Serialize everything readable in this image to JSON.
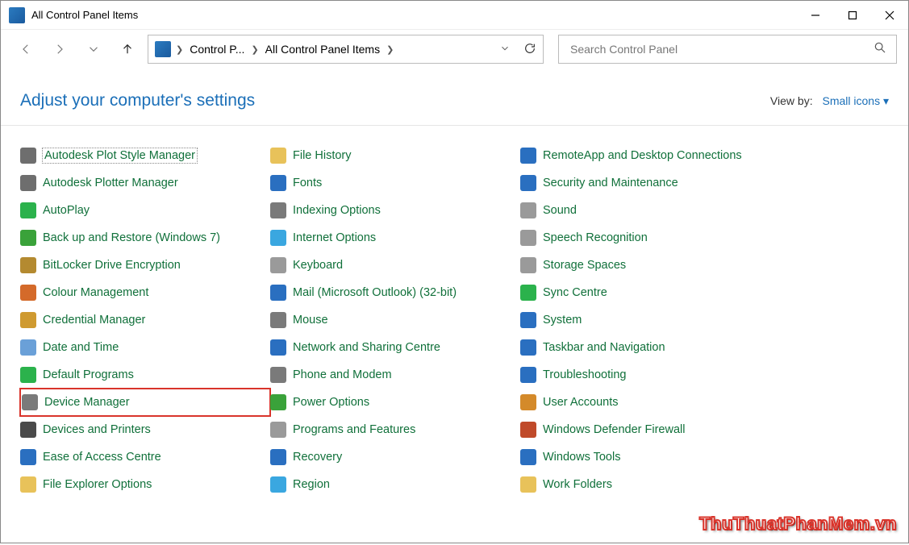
{
  "window": {
    "title": "All Control Panel Items"
  },
  "breadcrumb": {
    "item0": "Control P...",
    "item1": "All Control Panel Items"
  },
  "search": {
    "placeholder": "Search Control Panel"
  },
  "header": {
    "title": "Adjust your computer's settings",
    "viewby_label": "View by:",
    "viewby_value": "Small icons"
  },
  "items": [
    {
      "label": "Autodesk Plot Style Manager",
      "ico": "#6e6e6e"
    },
    {
      "label": "Autodesk Plotter Manager",
      "ico": "#6e6e6e"
    },
    {
      "label": "AutoPlay",
      "ico": "#2bb24c"
    },
    {
      "label": "Back up and Restore (Windows 7)",
      "ico": "#3aa23a"
    },
    {
      "label": "BitLocker Drive Encryption",
      "ico": "#b48a30"
    },
    {
      "label": "Colour Management",
      "ico": "#d46a2a"
    },
    {
      "label": "Credential Manager",
      "ico": "#cf9a30"
    },
    {
      "label": "Date and Time",
      "ico": "#6aa0d8"
    },
    {
      "label": "Default Programs",
      "ico": "#2bb24c"
    },
    {
      "label": "Device Manager",
      "ico": "#7a7a7a"
    },
    {
      "label": "Devices and Printers",
      "ico": "#4a4a4a"
    },
    {
      "label": "Ease of Access Centre",
      "ico": "#2a6fc0"
    },
    {
      "label": "File Explorer Options",
      "ico": "#e8c25a"
    },
    {
      "label": "File History",
      "ico": "#e8c25a"
    },
    {
      "label": "Fonts",
      "ico": "#2a6fc0"
    },
    {
      "label": "Indexing Options",
      "ico": "#7a7a7a"
    },
    {
      "label": "Internet Options",
      "ico": "#3aa7e0"
    },
    {
      "label": "Keyboard",
      "ico": "#9a9a9a"
    },
    {
      "label": "Mail (Microsoft Outlook) (32-bit)",
      "ico": "#2a6fc0"
    },
    {
      "label": "Mouse",
      "ico": "#7a7a7a"
    },
    {
      "label": "Network and Sharing Centre",
      "ico": "#2a6fc0"
    },
    {
      "label": "Phone and Modem",
      "ico": "#7a7a7a"
    },
    {
      "label": "Power Options",
      "ico": "#3aa23a"
    },
    {
      "label": "Programs and Features",
      "ico": "#9a9a9a"
    },
    {
      "label": "Recovery",
      "ico": "#2a6fc0"
    },
    {
      "label": "Region",
      "ico": "#3aa7e0"
    },
    {
      "label": "RemoteApp and Desktop Connections",
      "ico": "#2a6fc0"
    },
    {
      "label": "Security and Maintenance",
      "ico": "#2a6fc0"
    },
    {
      "label": "Sound",
      "ico": "#9a9a9a"
    },
    {
      "label": "Speech Recognition",
      "ico": "#9a9a9a"
    },
    {
      "label": "Storage Spaces",
      "ico": "#9a9a9a"
    },
    {
      "label": "Sync Centre",
      "ico": "#2bb24c"
    },
    {
      "label": "System",
      "ico": "#2a6fc0"
    },
    {
      "label": "Taskbar and Navigation",
      "ico": "#2a6fc0"
    },
    {
      "label": "Troubleshooting",
      "ico": "#2a6fc0"
    },
    {
      "label": "User Accounts",
      "ico": "#d48a2a"
    },
    {
      "label": "Windows Defender Firewall",
      "ico": "#c04a2a"
    },
    {
      "label": "Windows Tools",
      "ico": "#2a6fc0"
    },
    {
      "label": "Work Folders",
      "ico": "#e8c25a"
    }
  ],
  "selected_index": 0,
  "highlighted_index": 9,
  "watermark": "ThuThuatPhanMem.vn"
}
